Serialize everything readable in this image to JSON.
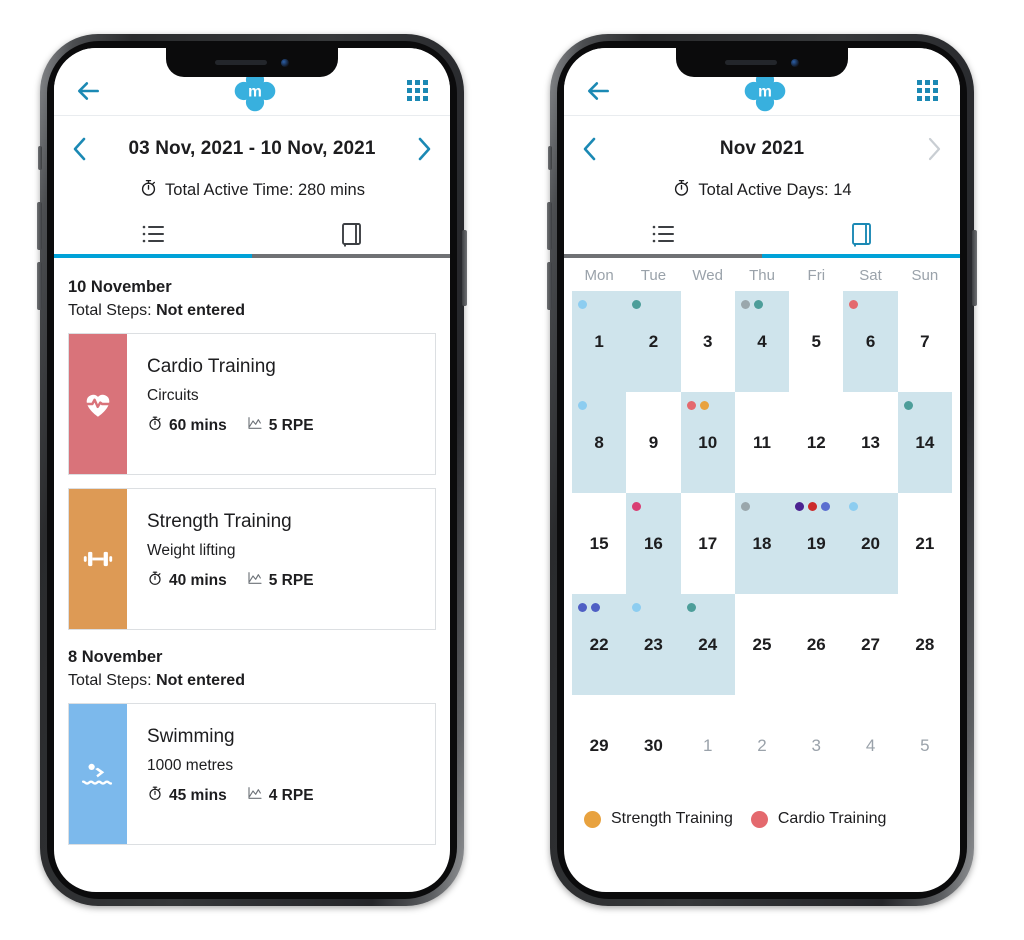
{
  "app": {
    "logo_letter": "m",
    "back_icon": "back-arrow-icon",
    "grid_icon": "grid-menu-icon",
    "accent": "#1b89b4",
    "tab_active_color": "#00a2d8",
    "tab_idle_color": "#6f7174"
  },
  "left_phone": {
    "period": {
      "label": "03 Nov, 2021 - 10 Nov, 2021",
      "prev_enabled": true,
      "next_enabled": true
    },
    "summary": {
      "icon": "stopwatch-icon",
      "text": "Total Active Time: 280 mins"
    },
    "tabs": [
      {
        "name": "list",
        "icon": "list-icon",
        "active": true
      },
      {
        "name": "calendar",
        "icon": "journal-icon",
        "active": false
      }
    ],
    "days": [
      {
        "title": "10 November",
        "steps_label": "Total Steps:",
        "steps_value": "Not entered",
        "activities": [
          {
            "title": "Cardio Training",
            "subtitle": "Circuits",
            "duration": "60 mins",
            "rpe": "5 RPE",
            "color": "#d9737a",
            "icon": "heart-pulse-icon"
          },
          {
            "title": "Strength Training",
            "subtitle": "Weight lifting",
            "duration": "40 mins",
            "rpe": "5 RPE",
            "color": "#dd9a55",
            "icon": "dumbbell-icon"
          }
        ]
      },
      {
        "title": "8 November",
        "steps_label": "Total Steps:",
        "steps_value": "Not entered",
        "activities": [
          {
            "title": "Swimming",
            "subtitle": "1000 metres",
            "duration": "45 mins",
            "rpe": "4 RPE",
            "color": "#7cb9ec",
            "icon": "swimmer-icon"
          }
        ]
      }
    ]
  },
  "right_phone": {
    "period": {
      "label": "Nov 2021",
      "prev_enabled": true,
      "next_enabled": false
    },
    "summary": {
      "icon": "stopwatch-icon",
      "text": "Total Active Days: 14"
    },
    "tabs": [
      {
        "name": "list",
        "icon": "list-icon",
        "active": false
      },
      {
        "name": "calendar",
        "icon": "journal-icon",
        "active": true
      }
    ],
    "weekday_headers": [
      "Mon",
      "Tue",
      "Wed",
      "Thu",
      "Fri",
      "Sat",
      "Sun"
    ],
    "highlight_color": "#cfe4ec",
    "weeks": [
      [
        {
          "num": "1",
          "active": true,
          "muted": false,
          "dots": [
            "#8dcdf0"
          ]
        },
        {
          "num": "2",
          "active": true,
          "muted": false,
          "dots": [
            "#4d9e9a"
          ]
        },
        {
          "num": "3",
          "active": false,
          "muted": false,
          "dots": []
        },
        {
          "num": "4",
          "active": true,
          "muted": false,
          "dots": [
            "#9aa7ac",
            "#4d9e9a"
          ]
        },
        {
          "num": "5",
          "active": false,
          "muted": false,
          "dots": []
        },
        {
          "num": "6",
          "active": true,
          "muted": false,
          "dots": [
            "#e4696e"
          ]
        },
        {
          "num": "7",
          "active": false,
          "muted": false,
          "dots": []
        }
      ],
      [
        {
          "num": "8",
          "active": true,
          "muted": false,
          "dots": [
            "#8dcdf0"
          ]
        },
        {
          "num": "9",
          "active": false,
          "muted": false,
          "dots": []
        },
        {
          "num": "10",
          "active": true,
          "muted": false,
          "dots": [
            "#e4696e",
            "#e8a23f"
          ]
        },
        {
          "num": "11",
          "active": false,
          "muted": false,
          "dots": []
        },
        {
          "num": "12",
          "active": false,
          "muted": false,
          "dots": []
        },
        {
          "num": "13",
          "active": false,
          "muted": false,
          "dots": []
        },
        {
          "num": "14",
          "active": true,
          "muted": false,
          "dots": [
            "#4d9e9a"
          ]
        }
      ],
      [
        {
          "num": "15",
          "active": false,
          "muted": false,
          "dots": []
        },
        {
          "num": "16",
          "active": true,
          "muted": false,
          "dots": [
            "#d93f74"
          ]
        },
        {
          "num": "17",
          "active": false,
          "muted": false,
          "dots": []
        },
        {
          "num": "18",
          "active": true,
          "muted": false,
          "dots": [
            "#9aa7ac"
          ]
        },
        {
          "num": "19",
          "active": true,
          "muted": false,
          "dots": [
            "#4b2391",
            "#cc2b2b",
            "#5b6fd0"
          ]
        },
        {
          "num": "20",
          "active": true,
          "muted": false,
          "dots": [
            "#8dcdf0"
          ]
        },
        {
          "num": "21",
          "active": false,
          "muted": false,
          "dots": []
        }
      ],
      [
        {
          "num": "22",
          "active": true,
          "muted": false,
          "dots": [
            "#4f5fc4",
            "#4f5fc4"
          ]
        },
        {
          "num": "23",
          "active": true,
          "muted": false,
          "dots": [
            "#8dcdf0"
          ]
        },
        {
          "num": "24",
          "active": true,
          "muted": false,
          "dots": [
            "#4d9e9a"
          ]
        },
        {
          "num": "25",
          "active": false,
          "muted": false,
          "dots": []
        },
        {
          "num": "26",
          "active": false,
          "muted": false,
          "dots": []
        },
        {
          "num": "27",
          "active": false,
          "muted": false,
          "dots": []
        },
        {
          "num": "28",
          "active": false,
          "muted": false,
          "dots": []
        }
      ],
      [
        {
          "num": "29",
          "active": false,
          "muted": false,
          "dots": []
        },
        {
          "num": "30",
          "active": false,
          "muted": false,
          "dots": []
        },
        {
          "num": "1",
          "active": false,
          "muted": true,
          "dots": []
        },
        {
          "num": "2",
          "active": false,
          "muted": true,
          "dots": []
        },
        {
          "num": "3",
          "active": false,
          "muted": true,
          "dots": []
        },
        {
          "num": "4",
          "active": false,
          "muted": true,
          "dots": []
        },
        {
          "num": "5",
          "active": false,
          "muted": true,
          "dots": []
        }
      ]
    ],
    "legend": [
      {
        "label": "Strength Training",
        "color": "#e8a23f"
      },
      {
        "label": "Cardio Training",
        "color": "#e4696e"
      }
    ]
  }
}
